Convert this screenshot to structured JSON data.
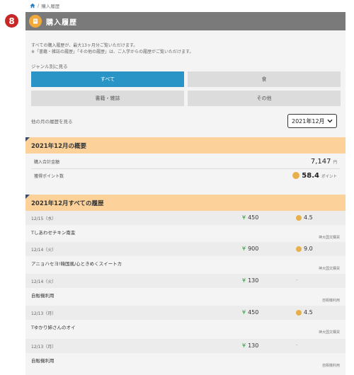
{
  "breadcrumb": {
    "current": "購入履歴",
    "separator": "/"
  },
  "step_badge": "8",
  "header": {
    "title": "購入履歴"
  },
  "notes": {
    "line1": "すべての購入履歴が、最大13ヶ月分ご覧いただけます。",
    "line2": "※「書籍・雑誌の履歴」「その他の履歴」は、ご入学からの履歴がご覧いただけます。"
  },
  "genre": {
    "label": "ジャンル別に見る",
    "buttons": [
      "すべて",
      "食",
      "書籍・雑誌",
      "その他"
    ],
    "active": "すべて"
  },
  "other_month": {
    "label": "他の月の履歴を見る",
    "selected": "2021年12月"
  },
  "summary": {
    "title": "2021年12月の概要",
    "total_label": "購入合計金額",
    "total_value": "7,147",
    "total_unit": "円",
    "points_label": "獲得ポイント数",
    "points_value": "58.4",
    "points_unit": "ポイント"
  },
  "history": {
    "title": "2021年12月すべての履歴",
    "yen_symbol": "¥",
    "items": [
      {
        "date": "12/15（水）",
        "price": "450",
        "points": "4.5",
        "name": "Tしあわせチキン南蛮",
        "store": "神大国文購買"
      },
      {
        "date": "12/14（火）",
        "price": "900",
        "points": "9.0",
        "name": "アニョハセヨ!韓国風/心ときめくスイートカ",
        "store": "神大国文購買"
      },
      {
        "date": "12/14（火）",
        "price": "130",
        "points": "-",
        "name": "自販機利用",
        "store": "自販機利用"
      },
      {
        "date": "12/13（月）",
        "price": "450",
        "points": "4.5",
        "name": "Tゆかり姉さんのオイ",
        "store": "神大国文購買"
      },
      {
        "date": "12/13（月）",
        "price": "130",
        "points": "-",
        "name": "自販機利用",
        "store": "自販機利用"
      }
    ]
  },
  "colors": {
    "header_bg": "#7a7a7a",
    "active_tab": "#2a94c6",
    "section_bg": "#fcd29a",
    "coin": "#e8b04c",
    "yen": "#2d9a3a",
    "badge": "#c62828"
  }
}
